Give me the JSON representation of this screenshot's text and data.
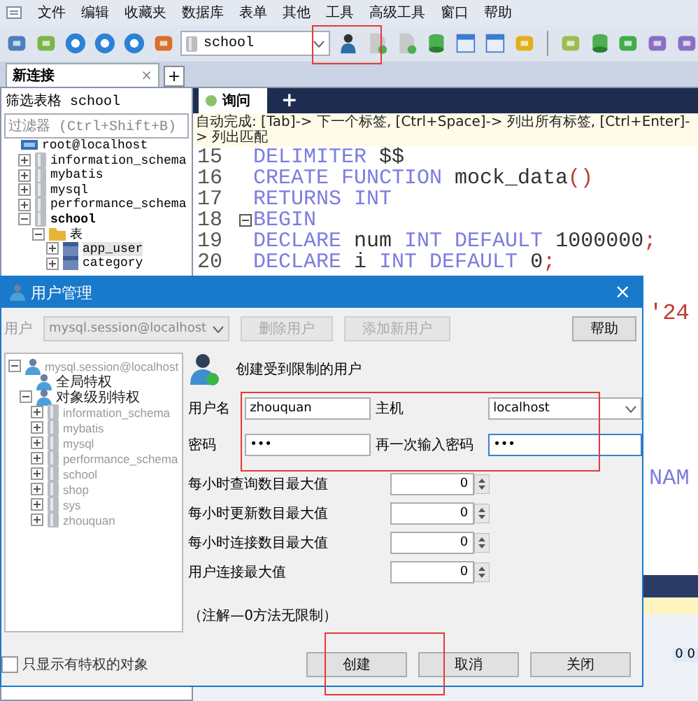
{
  "menu": [
    "文件",
    "编辑",
    "收藏夹",
    "数据库",
    "表单",
    "其他",
    "工具",
    "高级工具",
    "窗口",
    "帮助"
  ],
  "toolbar": {
    "database_select": "school"
  },
  "connection_tabs": [
    {
      "label": "新连接",
      "selected": true,
      "close": "×"
    }
  ],
  "new_tab": "+",
  "navigator": {
    "title": "筛选表格 school",
    "filter_placeholder": "过滤器 (Ctrl+Shift+B)",
    "tree": [
      {
        "label": "root@localhost",
        "kind": "server",
        "children": [
          {
            "label": "information_schema",
            "kind": "database",
            "expanded": false
          },
          {
            "label": "mybatis",
            "kind": "database",
            "expanded": false
          },
          {
            "label": "mysql",
            "kind": "database",
            "expanded": false
          },
          {
            "label": "performance_schema",
            "kind": "database",
            "expanded": false
          },
          {
            "label": "school",
            "kind": "database",
            "expanded": true,
            "bold": true,
            "children": [
              {
                "label": "表",
                "kind": "folder",
                "expanded": true,
                "children": [
                  {
                    "label": "app_user",
                    "kind": "table",
                    "expanded": false,
                    "selected": true
                  },
                  {
                    "label": "category",
                    "kind": "table",
                    "expanded": false,
                    "selected": false
                  }
                ]
              }
            ]
          }
        ]
      }
    ]
  },
  "editor": {
    "tabs": [
      {
        "label": "询问",
        "selected": true
      }
    ],
    "new_tab": "+",
    "hint": "自动完成: [Tab]-> 下一个标签, [Ctrl+Space]-> 列出所有标签, [Ctrl+Enter]-> 列出匹配",
    "lines": [
      {
        "number": "15",
        "fold": false,
        "tokens": [
          {
            "text": "DELIMITER ",
            "kind": "keyword"
          },
          {
            "text": "$$",
            "kind": "plain"
          }
        ]
      },
      {
        "number": "16",
        "fold": false,
        "tokens": [
          {
            "text": "CREATE FUNCTION ",
            "kind": "keyword"
          },
          {
            "text": "mock_data",
            "kind": "plain"
          },
          {
            "text": "()",
            "kind": "punct"
          }
        ]
      },
      {
        "number": "17",
        "fold": false,
        "tokens": [
          {
            "text": "RETURNS INT",
            "kind": "keyword"
          }
        ]
      },
      {
        "number": "18",
        "fold": true,
        "tokens": [
          {
            "text": "BEGIN",
            "kind": "keyword"
          }
        ]
      },
      {
        "number": "19",
        "fold": false,
        "tokens": [
          {
            "text": "DECLARE ",
            "kind": "keyword"
          },
          {
            "text": "num ",
            "kind": "plain"
          },
          {
            "text": "INT DEFAULT ",
            "kind": "keyword"
          },
          {
            "text": "1000000",
            "kind": "plain"
          },
          {
            "text": ";",
            "kind": "punct"
          }
        ]
      },
      {
        "number": "20",
        "fold": false,
        "tokens": [
          {
            "text": "DECLARE ",
            "kind": "keyword"
          },
          {
            "text": "i ",
            "kind": "plain"
          },
          {
            "text": "INT DEFAULT ",
            "kind": "keyword"
          },
          {
            "text": "0",
            "kind": "plain"
          },
          {
            "text": ";",
            "kind": "punct"
          }
        ]
      }
    ],
    "fragments": [
      {
        "text": "'24",
        "kind": "string"
      },
      {
        "text": "NAM",
        "kind": "keyword"
      }
    ],
    "result_cell": "0 0"
  },
  "dialog": {
    "title": "用户管理",
    "close": "×",
    "user_label": "用户",
    "user_select": "mysql.session@localhost",
    "buttons": [
      {
        "label": "删除用户",
        "disabled": true
      },
      {
        "label": "添加新用户",
        "disabled": true
      },
      {
        "label": "帮助",
        "disabled": false
      }
    ],
    "tree": [
      {
        "label": "mysql.session@localhost",
        "kind": "user",
        "expanded": true,
        "disabled": true,
        "children": [
          {
            "label": "全局特权",
            "kind": "user",
            "disabled": false
          },
          {
            "label": "对象级别特权",
            "kind": "user",
            "expanded": true,
            "disabled": false,
            "children": [
              {
                "label": "information_schema",
                "kind": "database",
                "expanded": false,
                "disabled": true
              },
              {
                "label": "mybatis",
                "kind": "database",
                "expanded": false,
                "disabled": true
              },
              {
                "label": "mysql",
                "kind": "database",
                "expanded": false,
                "disabled": true
              },
              {
                "label": "performance_schema",
                "kind": "database",
                "expanded": false,
                "disabled": true
              },
              {
                "label": "school",
                "kind": "database",
                "expanded": false,
                "disabled": true
              },
              {
                "label": "shop",
                "kind": "database",
                "expanded": false,
                "disabled": true
              },
              {
                "label": "sys",
                "kind": "database",
                "expanded": false,
                "disabled": true
              },
              {
                "label": "zhouquan",
                "kind": "database",
                "expanded": false,
                "disabled": true
              }
            ]
          }
        ]
      }
    ],
    "section_title": "创建受到限制的用户",
    "fields": [
      {
        "label": "用户名",
        "value": "zhouquan",
        "kind": "text"
      },
      {
        "label": "主机",
        "value": "localhost",
        "kind": "select"
      },
      {
        "label": "密码",
        "value": "•••",
        "kind": "text"
      },
      {
        "label": "再一次输入密码",
        "value": "•••",
        "kind": "text",
        "focused": true
      }
    ],
    "limits": [
      {
        "label": "每小时查询数目最大值",
        "value": "0"
      },
      {
        "label": "每小时更新数目最大值",
        "value": "0"
      },
      {
        "label": "每小时连接数目最大值",
        "value": "0"
      },
      {
        "label": "用户连接最大值",
        "value": "0"
      }
    ],
    "note": "（注解—0方法无限制）",
    "show_privileged_only": {
      "label": "只显示有特权的对象",
      "checked": false
    },
    "actions": [
      "创建",
      "取消",
      "关闭"
    ]
  }
}
